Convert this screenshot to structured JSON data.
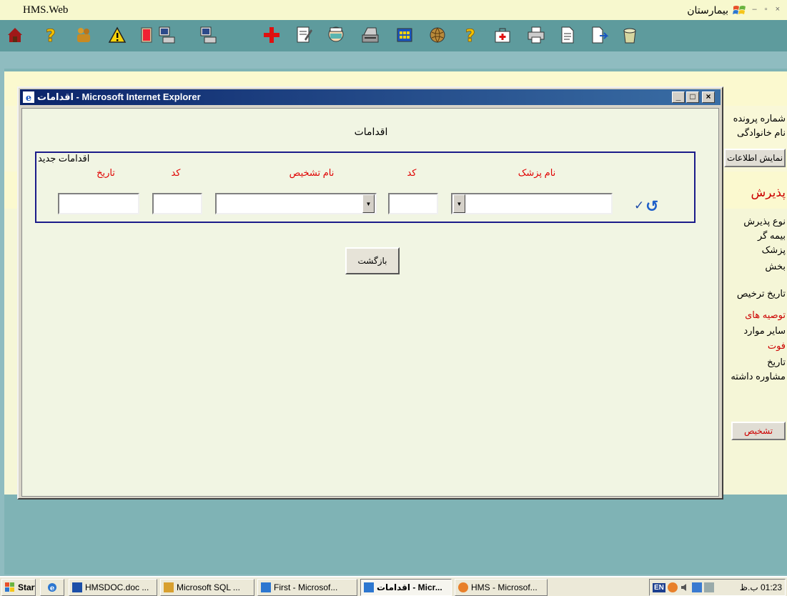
{
  "app": {
    "title_left": "HMS.Web",
    "title_right": "بیمارستان",
    "window_controls": "– ▫ ×"
  },
  "toolbar": {
    "icons": [
      "home-icon",
      "help-icon",
      "people-icon",
      "warning-icon",
      "door-exit-icon",
      "computer-icon",
      "computer-icon",
      "red-cross-icon",
      "edit-form-icon",
      "doctor-icon",
      "scanner-icon",
      "grid-window-icon",
      "globe-icon",
      "help-icon",
      "first-aid-icon",
      "printer-icon",
      "document-icon",
      "document-arrow-icon",
      "bucket-icon"
    ]
  },
  "background_page": {
    "lines": [
      {
        "text": "شماره پرونده",
        "red": false
      },
      {
        "text": "نام خانوادگی",
        "red": false
      },
      {
        "text": "نمایش اطلاعات",
        "red": false,
        "button": true
      },
      {
        "text": "پذیرش",
        "red": true
      },
      {
        "text": "نوع پذیرش",
        "red": false
      },
      {
        "text": "بیمه گر",
        "red": false
      },
      {
        "text": "پزشک",
        "red": false
      },
      {
        "text": "بخش",
        "red": false
      },
      {
        "text": "تاریخ ترخیص",
        "red": false
      },
      {
        "text": "توصیه های",
        "red": true
      },
      {
        "text": "سایر موارد",
        "red": false
      },
      {
        "text": "فوت",
        "red": true
      },
      {
        "text": "تاریخ",
        "red": false
      },
      {
        "text": "مشاوره داشته",
        "red": false
      },
      {
        "text": "تشخیص",
        "red": true,
        "button": true
      }
    ]
  },
  "dialog": {
    "title": "اقدامات - Microsoft Internet Explorer",
    "heading": "اقدامات",
    "fieldset_legend": "اقدامات جدید",
    "columns": {
      "doctor_name": "نام پزشک",
      "doctor_code": "کد",
      "diagnosis_name": "نام تشخیص",
      "diagnosis_code": "کد",
      "date": "تاریخ"
    },
    "fields": {
      "doctor_name_value": "",
      "doctor_code_value": "",
      "diagnosis_name_value": "",
      "diagnosis_code_value": "",
      "date_value": ""
    },
    "back_button": "بازگشت"
  },
  "taskbar": {
    "start": "Start",
    "items": [
      {
        "label": "HMSDOC.doc ...",
        "active": false
      },
      {
        "label": "Microsoft SQL ...",
        "active": false
      },
      {
        "label": "First - Microsof...",
        "active": false
      },
      {
        "label": "اقدامات - Micr...",
        "active": true
      },
      {
        "label": "HMS - Microsof...",
        "active": false
      }
    ],
    "lang": "EN",
    "clock": "01:23 ب.ظ"
  },
  "colors": {
    "toolbar": "#5e9b9d",
    "dialog_title_start": "#0b246a",
    "label_red": "#e00000",
    "fieldset_border": "#1b1b8a"
  }
}
